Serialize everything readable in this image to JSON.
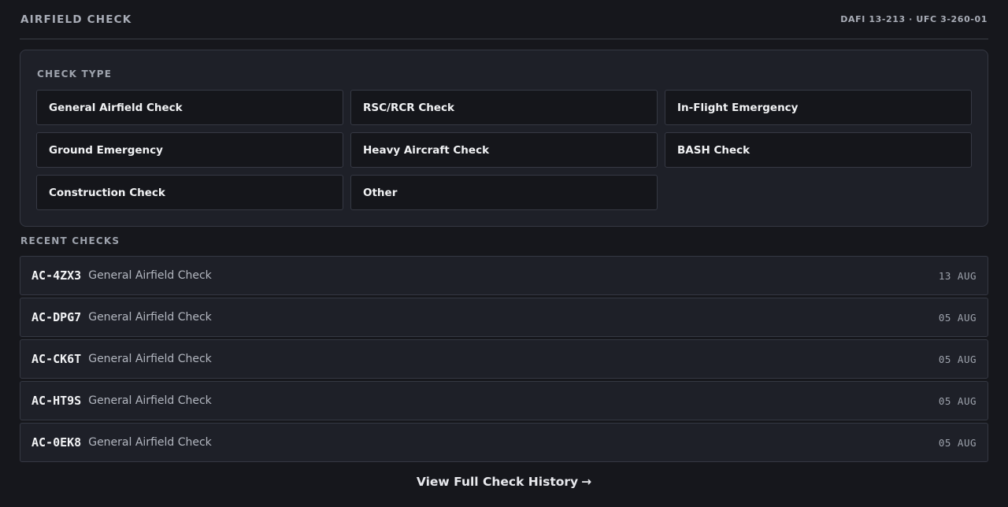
{
  "header": {
    "title": "AIRFIELD CHECK",
    "reference": "DAFI 13-213 · UFC 3-260-01"
  },
  "check_type": {
    "label": "CHECK TYPE",
    "options": [
      "General Airfield Check",
      "RSC/RCR Check",
      "In-Flight Emergency",
      "Ground Emergency",
      "Heavy Aircraft Check",
      "BASH Check",
      "Construction Check",
      "Other"
    ]
  },
  "recent": {
    "label": "RECENT CHECKS",
    "rows": [
      {
        "id": "AC-4ZX3",
        "type": "General Airfield Check",
        "date": "13 AUG"
      },
      {
        "id": "AC-DPG7",
        "type": "General Airfield Check",
        "date": "05 AUG"
      },
      {
        "id": "AC-CK6T",
        "type": "General Airfield Check",
        "date": "05 AUG"
      },
      {
        "id": "AC-HT9S",
        "type": "General Airfield Check",
        "date": "05 AUG"
      },
      {
        "id": "AC-0EK8",
        "type": "General Airfield Check",
        "date": "05 AUG"
      }
    ]
  },
  "footer": {
    "history_link": "View Full Check History",
    "arrow": "→"
  }
}
